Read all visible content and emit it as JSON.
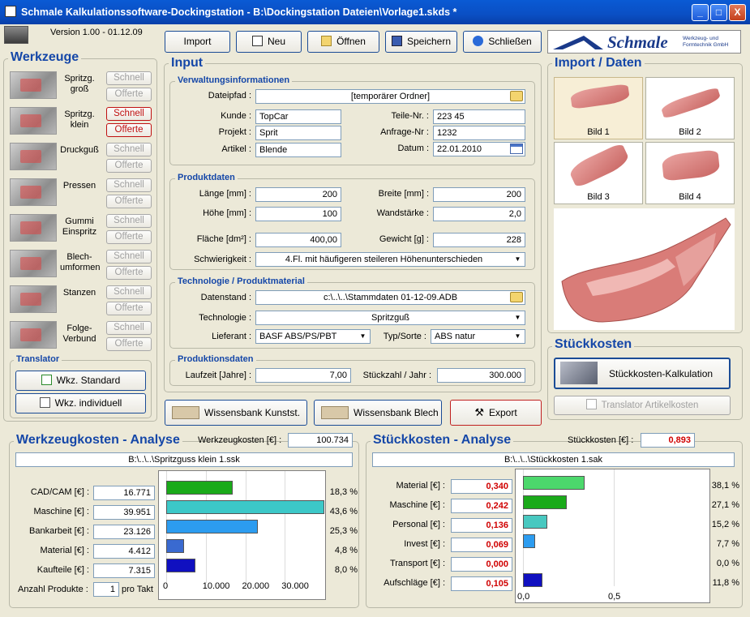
{
  "window": {
    "title": "Schmale Kalkulationssoftware-Dockingstation  -  B:\\Dockingstation Dateien\\Vorlage1.skds *",
    "minimize": "_",
    "maximize": "□",
    "close": "X"
  },
  "version": "Version 1.00 - 01.12.09",
  "toolbar": {
    "import": "Import",
    "neu": "Neu",
    "oeffnen": "Öffnen",
    "speichern": "Speichern",
    "schliessen": "Schließen"
  },
  "logo": {
    "brand": "Schmale",
    "sub": "Werkzeug- und Formtechnik GmbH"
  },
  "werkzeuge": {
    "title": "Werkzeuge",
    "items": [
      {
        "label": "Spritzg. groß",
        "schnell": "Schnell",
        "offerte": "Offerte"
      },
      {
        "label": "Spritzg. klein",
        "schnell": "Schnell",
        "offerte": "Offerte"
      },
      {
        "label": "Druckguß",
        "schnell": "Schnell",
        "offerte": "Offerte"
      },
      {
        "label": "Pressen",
        "schnell": "Schnell",
        "offerte": "Offerte"
      },
      {
        "label": "Gummi Einspritz",
        "schnell": "Schnell",
        "offerte": "Offerte"
      },
      {
        "label": "Blech-umformen",
        "schnell": "Schnell",
        "offerte": "Offerte"
      },
      {
        "label": "Stanzen",
        "schnell": "Schnell",
        "offerte": "Offerte"
      },
      {
        "label": "Folge-Verbund",
        "schnell": "Schnell",
        "offerte": "Offerte"
      }
    ]
  },
  "translator": {
    "title": "Translator",
    "standard": "Wkz. Standard",
    "individuell": "Wkz. individuell"
  },
  "input": {
    "title": "Input",
    "verwaltung": {
      "title": "Verwaltungsinformationen",
      "dateipfad_label": "Dateipfad :",
      "dateipfad": "[temporärer Ordner]",
      "kunde_label": "Kunde :",
      "kunde": "TopCar",
      "projekt_label": "Projekt :",
      "projekt": "Sprit",
      "artikel_label": "Artikel :",
      "artikel": "Blende",
      "teilenr_label": "Teile-Nr. :",
      "teilenr": "223 45",
      "anfragenr_label": "Anfrage-Nr :",
      "anfragenr": "1232",
      "datum_label": "Datum :",
      "datum": "22.01.2010"
    },
    "produkt": {
      "title": "Produktdaten",
      "laenge_label": "Länge [mm] :",
      "laenge": "200",
      "breite_label": "Breite [mm] :",
      "breite": "200",
      "hoehe_label": "Höhe [mm] :",
      "hoehe": "100",
      "wand_label": "Wandstärke :",
      "wand": "2,0",
      "flaeche_label": "Fläche [dm²] :",
      "flaeche": "400,00",
      "gewicht_label": "Gewicht [g] :",
      "gewicht": "228",
      "schwierig_label": "Schwierigkeit :",
      "schwierig": "4.Fl. mit häufigeren steileren Höhenunterschieden"
    },
    "technologie": {
      "title": "Technologie / Produktmaterial",
      "datenstand_label": "Datenstand :",
      "datenstand": "c:\\..\\..\\Stammdaten 01-12-09.ADB",
      "tech_label": "Technologie :",
      "tech": "Spritzguß",
      "lieferant_label": "Lieferant :",
      "lieferant": "BASF   ABS/PS/PBT",
      "typ_label": "Typ/Sorte :",
      "typ": "ABS natur"
    },
    "produktion": {
      "title": "Produktionsdaten",
      "laufzeit_label": "Laufzeit [Jahre] :",
      "laufzeit": "7,00",
      "stueckzahl_label": "Stückzahl / Jahr :",
      "stueckzahl": "300.000"
    }
  },
  "wissen": {
    "kunst": "Wissensbank Kunstst.",
    "blech": "Wissensbank Blech",
    "export": "Export"
  },
  "import_daten": {
    "title": "Import / Daten",
    "bilder": [
      "Bild 1",
      "Bild 2",
      "Bild 3",
      "Bild 4"
    ]
  },
  "stueckkosten": {
    "title": "Stückkosten",
    "kalk": "Stückkosten-Kalkulation",
    "translator": "Translator Artikelkosten"
  },
  "wkz_analyse": {
    "title": "Werkzeugkosten - Analyse",
    "kosten_label": "Werkzeugkosten [€] :",
    "kosten": "100.734",
    "file": "B:\\..\\..\\Spritzguss klein 1.ssk",
    "rows": [
      {
        "label": "CAD/CAM [€] :",
        "value": "16.771",
        "pct": "18,3 %"
      },
      {
        "label": "Maschine [€] :",
        "value": "39.951",
        "pct": "43,6 %"
      },
      {
        "label": "Bankarbeit [€] :",
        "value": "23.126",
        "pct": "25,3 %"
      },
      {
        "label": "Material [€] :",
        "value": "4.412",
        "pct": "4,8 %"
      },
      {
        "label": "Kaufteile [€] :",
        "value": "7.315",
        "pct": "8,0 %"
      }
    ],
    "anzahl_label": "Anzahl Produkte :",
    "anzahl": "1",
    "pro_takt": "pro Takt",
    "axis": [
      "0",
      "10.000",
      "20.000",
      "30.000"
    ]
  },
  "stk_analyse": {
    "title": "Stückkosten - Analyse",
    "kosten_label": "Stückkosten [€] :",
    "kosten": "0,893",
    "file": "B:\\..\\..\\Stückkosten 1.sak",
    "rows": [
      {
        "label": "Material [€] :",
        "value": "0,340",
        "pct": "38,1 %"
      },
      {
        "label": "Maschine [€] :",
        "value": "0,242",
        "pct": "27,1 %"
      },
      {
        "label": "Personal [€] :",
        "value": "0,136",
        "pct": "15,2 %"
      },
      {
        "label": "Invest [€] :",
        "value": "0,069",
        "pct": "7,7 %"
      },
      {
        "label": "Transport [€] :",
        "value": "0,000",
        "pct": "0,0 %"
      },
      {
        "label": "Aufschläge [€] :",
        "value": "0,105",
        "pct": "11,8 %"
      }
    ],
    "axis": [
      "0,0",
      "0,5"
    ]
  },
  "chart_data": [
    {
      "type": "bar",
      "categories": [
        "CAD/CAM",
        "Maschine",
        "Bankarbeit",
        "Material",
        "Kaufteile"
      ],
      "values": [
        16771,
        39951,
        23126,
        4412,
        7315
      ],
      "xlim": [
        0,
        40000
      ],
      "colors": [
        "#1aaa1a",
        "#3cc8c8",
        "#2c9cf0",
        "#3a6ad0",
        "#1010c0"
      ]
    },
    {
      "type": "bar",
      "categories": [
        "Material",
        "Maschine",
        "Personal",
        "Invest",
        "Transport",
        "Aufschläge"
      ],
      "values": [
        0.34,
        0.242,
        0.136,
        0.069,
        0.0,
        0.105
      ],
      "xlim": [
        0,
        1.0
      ],
      "colors": [
        "#4cd86c",
        "#1aaa1a",
        "#48c8c0",
        "#2c9cf0",
        "#3a6ad0",
        "#1010c0"
      ]
    }
  ]
}
